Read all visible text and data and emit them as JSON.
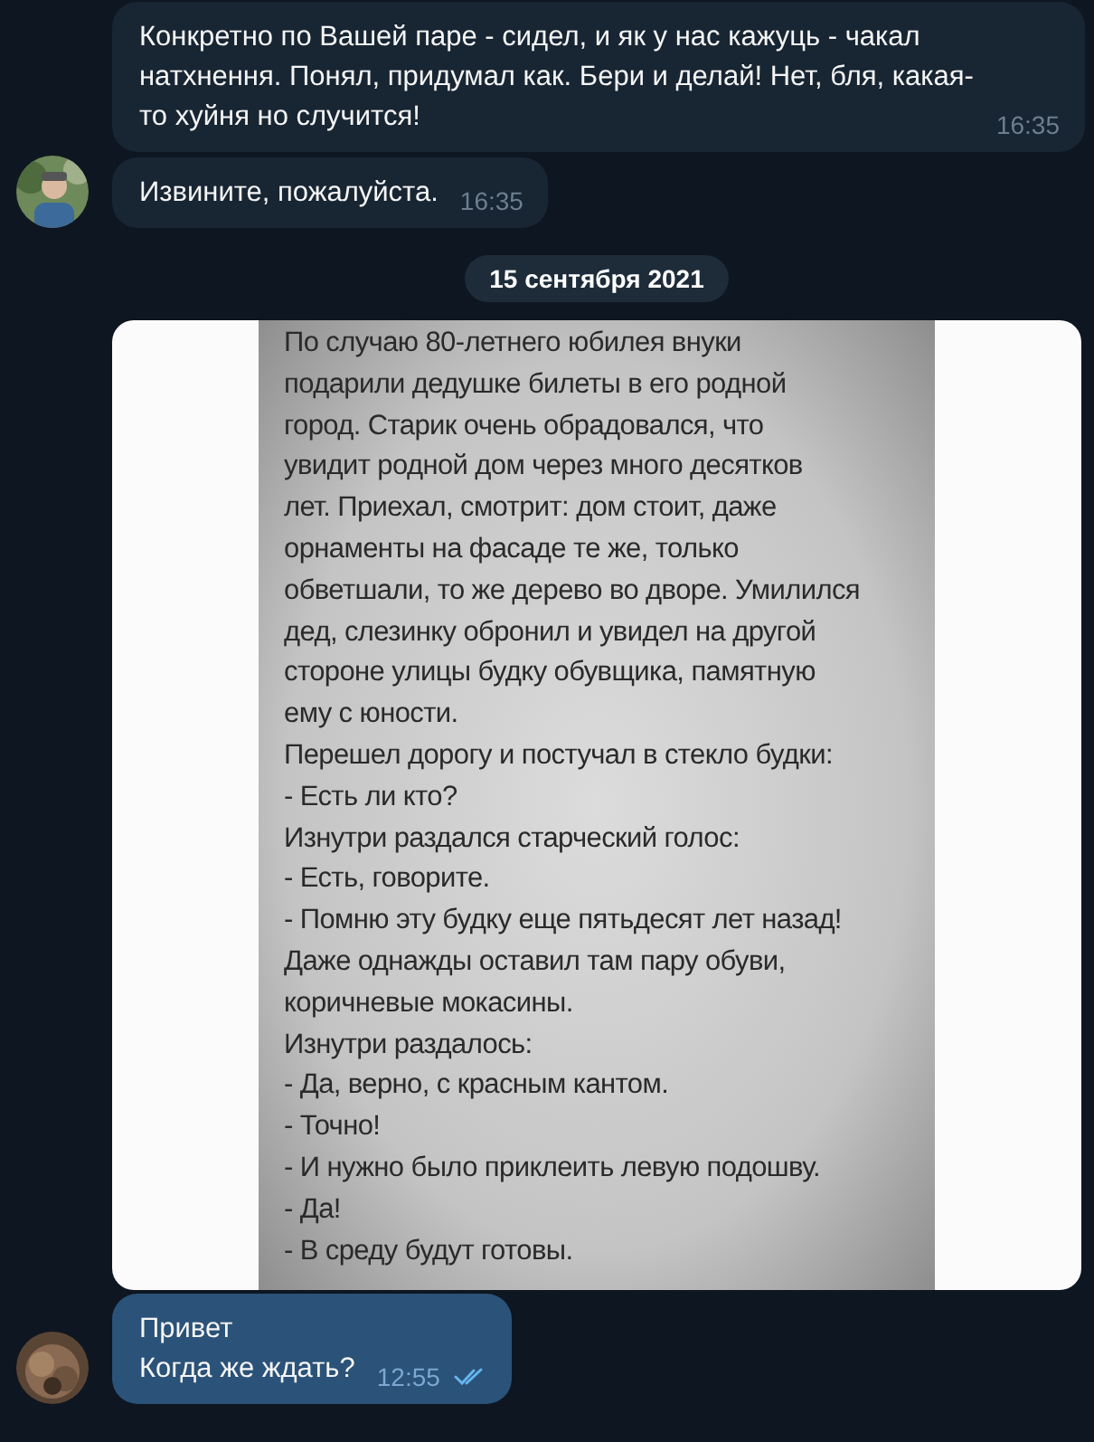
{
  "messages": [
    {
      "kind": "text",
      "own": false,
      "lines": [
        "Конкретно по Вашей паре - сидел, и як у нас кажуць - чакал натхнення. Понял, придумал как. Бери и делай! Нет, бля, какая-то хуйня но случится!"
      ],
      "time": "16:35"
    },
    {
      "kind": "text",
      "own": false,
      "avatar": {
        "kind": "picture"
      },
      "lines": [
        "Извините, пожалуйста."
      ],
      "time": "16:35"
    },
    {
      "kind": "date",
      "text": "15 сентября 2021"
    },
    {
      "document_lines": [
        "По случаю 80-летнего юбилея внуки",
        "подарили дедушке билеты в его родной",
        "город. Старик очень обрадовался, что",
        "увидит родной дом через много десятков",
        "лет. Приехал, смотрит: дом стоит, даже",
        "орнаменты на фасаде те же, только",
        "обветшали, то же дерево во дворе. Умилился",
        "дед, слезинку обронил и увидел на другой",
        "стороне улицы будку обувщика, памятную",
        "ему с юности.",
        "Перешел дорогу и постучал в стекло будки:",
        "- Есть ли кто?",
        "Изнутри раздался старческий голос:",
        "- Есть, говорите.",
        "- Помню эту будку еще пятьдесят лет назад!",
        "Даже однажды оставил там пару обуви,",
        "коричневые мокасины.",
        "Изнутри раздалось:",
        "- Да, верно, с красным кантом.",
        "- Точно!",
        "- И нужно было приклеить левую подошву.",
        "- Да!",
        "- В среду будут готовы."
      ]
    },
    {
      "kind": "text",
      "own": true,
      "avatar": {
        "kind": "picture"
      },
      "lines": [
        "Привет",
        "Когда же ждать?"
      ],
      "time": "12:55",
      "read": true
    }
  ]
}
